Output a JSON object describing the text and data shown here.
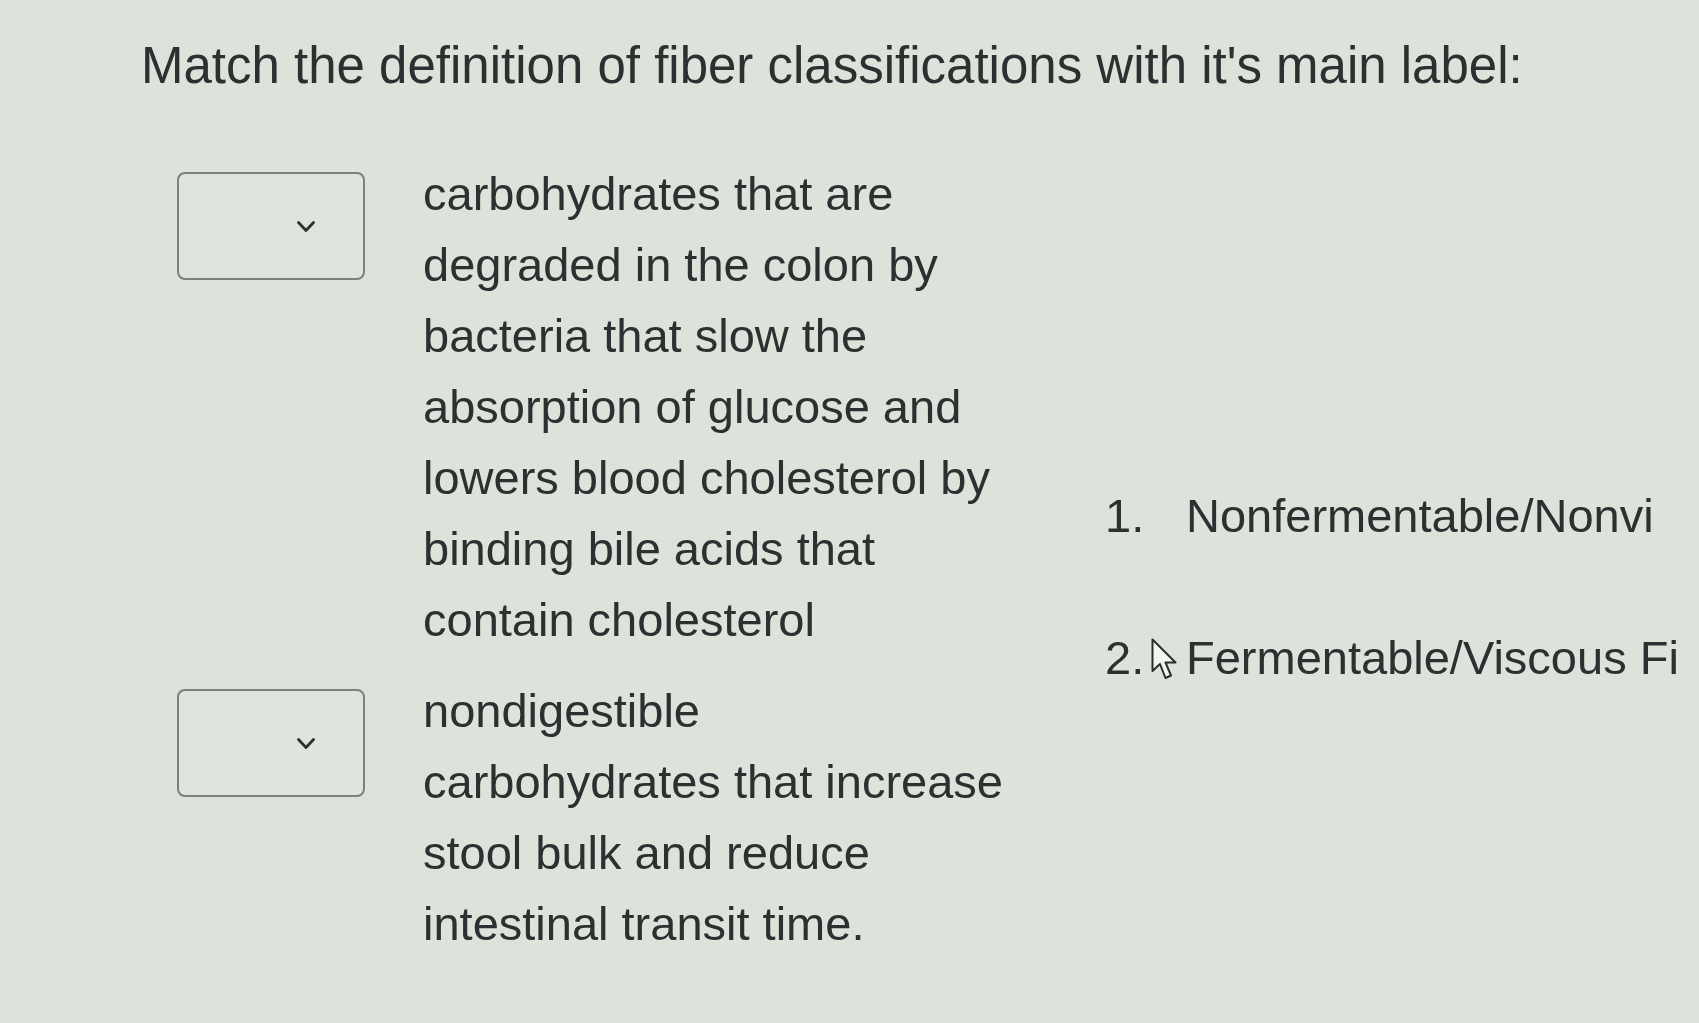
{
  "prompt": "Match the definition of fiber classifications with it's main label:",
  "pairs": [
    {
      "definition": "carbohydrates that are degraded in the colon by bacteria that slow the absorption of glucose and lowers blood cholesterol by binding bile acids that contain cholesterol"
    },
    {
      "definition": "nondigestible carbohydrates that increase stool bulk and reduce intestinal transit time."
    }
  ],
  "options": [
    {
      "number": "1.",
      "label": "Nonfermentable/Nonvi"
    },
    {
      "number": "2.",
      "label": "Fermentable/Viscous Fi"
    }
  ]
}
